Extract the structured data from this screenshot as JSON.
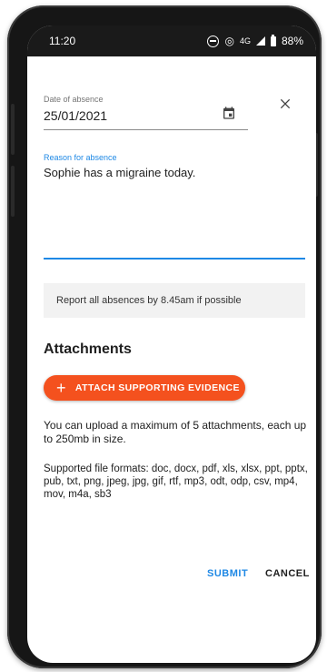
{
  "status_bar": {
    "time": "11:20",
    "network": "4G",
    "battery": "88%"
  },
  "form": {
    "date_label": "Date of absence",
    "date_value": "25/01/2021",
    "reason_label": "Reason for absence",
    "reason_value": "Sophie has a migraine today.",
    "info_text": "Report all absences by 8.45am if possible"
  },
  "attachments": {
    "heading": "Attachments",
    "attach_button_label": "ATTACH SUPPORTING EVIDENCE",
    "upload_limit_text": "You can upload a maximum of 5 attachments, each up to 250mb in size.",
    "formats_text": "Supported file formats: doc, docx, pdf, xls, xlsx, ppt, pptx, pub, txt, png, jpeg, jpg, gif, rtf, mp3, odt, odp, csv, mp4, mov, m4a, sb3"
  },
  "actions": {
    "submit_label": "SUBMIT",
    "cancel_label": "CANCEL"
  },
  "colors": {
    "accent": "#1e88e5",
    "button": "#f4511e"
  },
  "icons": {
    "close": "close-icon",
    "calendar": "calendar-icon",
    "plus": "plus-icon"
  }
}
